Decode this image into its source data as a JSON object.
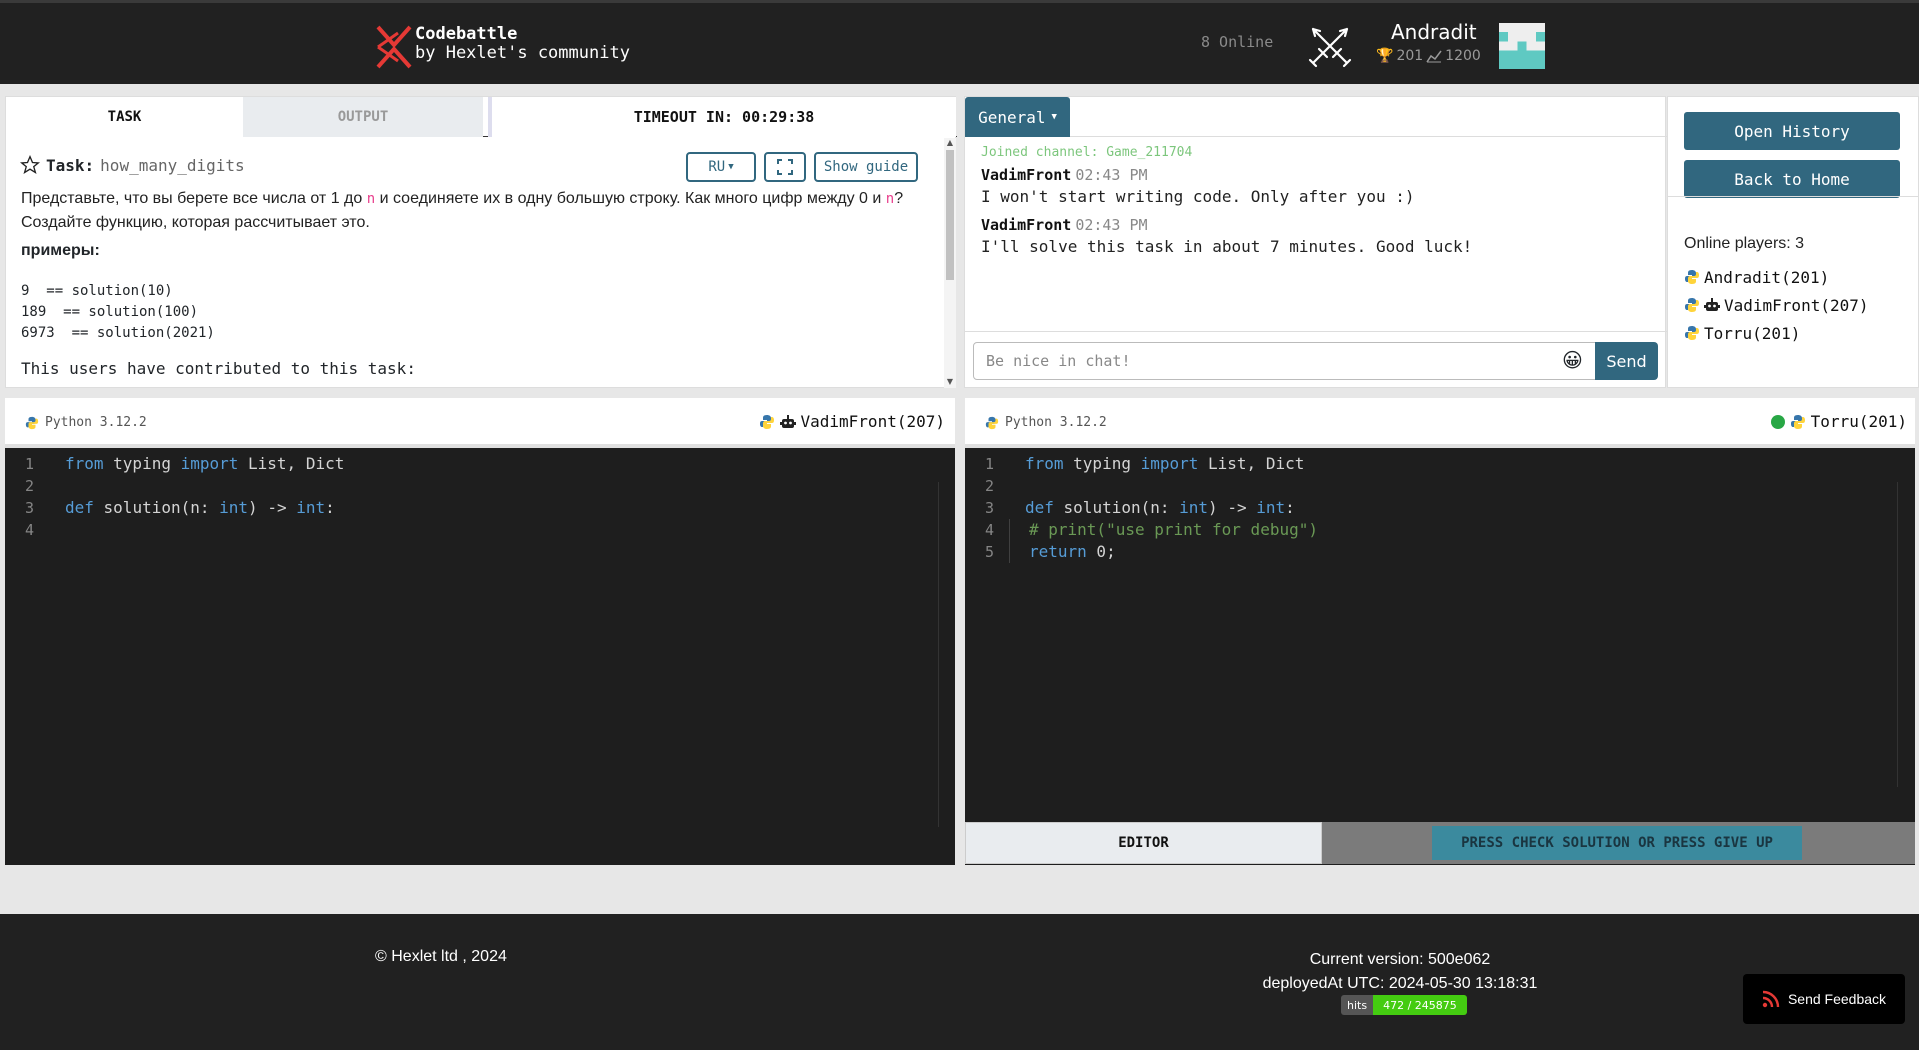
{
  "header": {
    "brand_line1": "Codebattle",
    "brand_line2": "by Hexlet's community",
    "online_count": "8 Online",
    "user": {
      "name": "Andradit",
      "rating": "201",
      "points": "1200"
    }
  },
  "task_panel": {
    "tabs": {
      "task": "TASK",
      "output": "OUTPUT",
      "timeout": "TIMEOUT IN: 00:29:38"
    },
    "task_label": "Task:",
    "task_name": "how_many_digits",
    "lang_button": "RU",
    "show_guide": "Show guide",
    "description_parts": [
      "Представьте, что вы берете все числа от 1 до ",
      "n",
      " и соединяете их в одну большую строку. Как много цифр между 0 и ",
      "n",
      "? Создайте функцию, которая рассчитывает это."
    ],
    "examples_heading": "примеры:",
    "examples": [
      "9  == solution(10)",
      "189  == solution(100)",
      "6973  == solution(2021)"
    ],
    "contributors_text": "This users have contributed to this task:"
  },
  "chat": {
    "channel_button": "General",
    "system_message": "Joined channel: Game_211704",
    "messages": [
      {
        "author": "VadimFront",
        "time": "02:43 PM",
        "text": "I won't start writing code. Only after you :)"
      },
      {
        "author": "VadimFront",
        "time": "02:43 PM",
        "text": "I'll solve this task in about 7 minutes. Good luck!"
      }
    ],
    "input_placeholder": "Be nice in chat!",
    "send_label": "Send"
  },
  "sidebar": {
    "open_history": "Open History",
    "back_home": "Back to Home",
    "online_players_label": "Online players: 3",
    "players": [
      "Andradit(201)",
      "VadimFront(207)",
      "Torru(201)"
    ]
  },
  "editors": {
    "left": {
      "language": "Python 3.12.2",
      "player": "VadimFront(207)",
      "lines": [
        "1",
        "2",
        "3",
        "4"
      ]
    },
    "right": {
      "language": "Python 3.12.2",
      "player": "Torru(201)",
      "lines": [
        "1",
        "2",
        "3",
        "4",
        "5"
      ],
      "editor_tab": "EDITOR",
      "press_button": "PRESS CHECK SOLUTION OR PRESS GIVE UP"
    }
  },
  "footer": {
    "copyright": "© Hexlet ltd , 2024",
    "version": "Current version: 500e062",
    "deployed": "deployedAt UTC: 2024-05-30 13:18:31",
    "hits_label": "hits",
    "hits_value": "472 / 245875",
    "feedback": "Send Feedback"
  },
  "colors": {
    "header_bg": "#212121",
    "accent": "#31677f",
    "online_dot": "#28a745",
    "logo_red": "#e53935"
  }
}
